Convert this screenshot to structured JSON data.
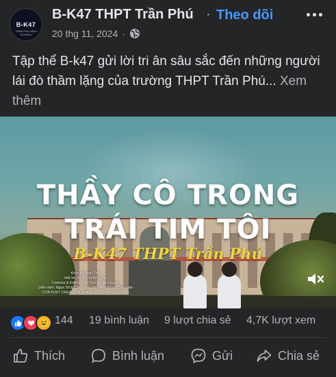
{
  "header": {
    "avatar_text": "B-K47",
    "avatar_subtext": "TRAN PHU HIGH SCHOOL",
    "page_name": "B-K47 THPT Trần Phú",
    "separator": "·",
    "follow_label": "Theo dõi",
    "date": "20 thg 11, 2024",
    "date_separator": "·",
    "privacy_icon": "globe-icon",
    "more_icon": "more-options-icon"
  },
  "caption": {
    "text": "Tập thể B-k47 gửi lời tri ân sâu sắc đến những người lái đò thầm lặng của trường THPT Trần Phú...",
    "see_more": "Xem thêm"
  },
  "video": {
    "title_line1": "THẦY CÔ TRONG",
    "title_line2": "TRÁI TIM TÔI",
    "subtitle": "B-K47 THPT Trần Phú",
    "credits": [
      "Khởi tác Anh Thư",
      "Viết lời: Bích Chi Anh Thư",
      "Camera & Editor: Anh Thư, Hoàn Quỳnh",
      "Diễn viên: Ngọc Bích Chi, Tuấn Việt, Anh Khoa, Bảo Hân",
      "CONTENT CREATION: ANH THƯ, HOÀI PHƯƠNG"
    ],
    "mute_icon": "muted-speaker-icon"
  },
  "stats": {
    "reaction_icons": [
      "like-icon",
      "love-icon",
      "haha-icon"
    ],
    "reaction_count": "144",
    "comments": "19 bình luận",
    "shares": "9 lượt chia sẻ",
    "views": "4,7K lượt xem"
  },
  "actions": {
    "like": "Thích",
    "comment": "Bình luận",
    "send": "Gửi",
    "share": "Chia sẻ"
  },
  "colors": {
    "background": "#242526",
    "text": "#e4e6eb",
    "secondary_text": "#b0b3b8",
    "link_blue": "#4599ff",
    "subtitle_yellow": "#f4d43c"
  }
}
